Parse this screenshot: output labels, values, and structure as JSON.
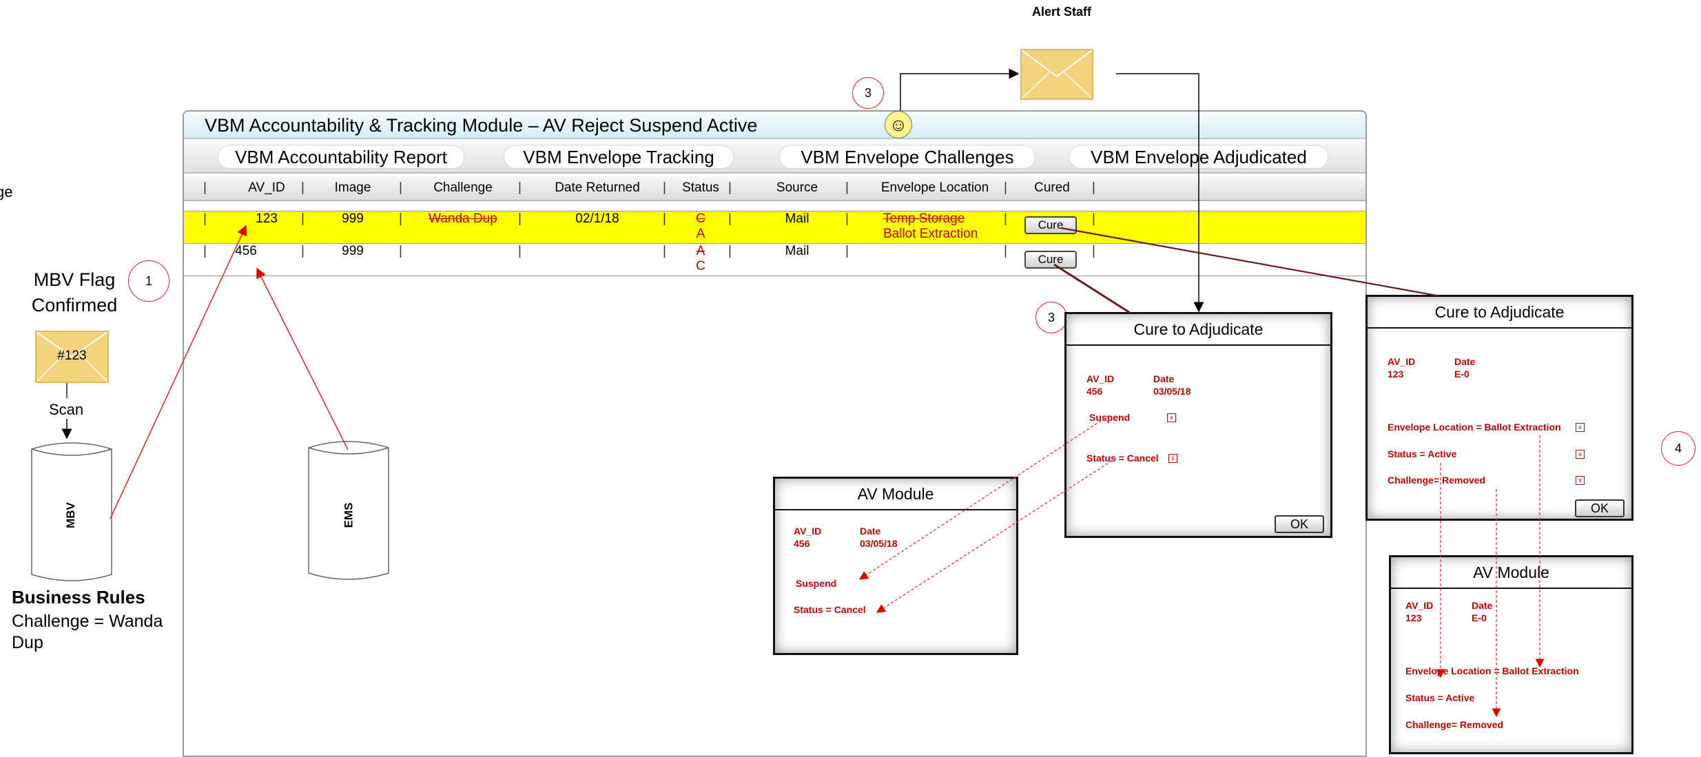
{
  "alert_staff": "Alert Staff",
  "module": {
    "title": "VBM Accountability & Tracking Module – AV Reject Suspend Active",
    "tabs": [
      "VBM Accountability Report",
      "VBM Envelope Tracking",
      "VBM Envelope Challenges",
      "VBM Envelope Adjudicated"
    ],
    "columns": [
      "AV_ID",
      "Image",
      "Challenge",
      "Date Returned",
      "Status",
      "Source",
      "Envelope Location",
      "Cured"
    ],
    "rows": [
      {
        "av_id": "123",
        "image": "999",
        "challenge": "Wanda Dup",
        "date_returned": "02/1/18",
        "status_old": "C",
        "status_new": "A",
        "source": "Mail",
        "location_old": "Temp Storage",
        "location_new": "Ballot Extraction",
        "cure": "Cure"
      },
      {
        "av_id": "456",
        "image": "999",
        "challenge": "",
        "date_returned": "",
        "status_old": "A",
        "status_new": "C",
        "source": "Mail",
        "location_old": "",
        "location_new": "",
        "cure": "Cure"
      }
    ]
  },
  "left": {
    "partial_label": "ge",
    "flag_label_1": "MBV Flag",
    "flag_label_2": "Confirmed",
    "step1": "1",
    "envelope_label": "#123",
    "scan": "Scan",
    "mbv": "MBV",
    "ems": "EMS",
    "rules_title": "Business Rules",
    "rules_text_1": "Challenge = Wanda",
    "rules_text_2": "Dup"
  },
  "steps": {
    "s3a": "3",
    "s3b": "3",
    "s4": "4"
  },
  "cure_dialog_456": {
    "title": "Cure to Adjudicate",
    "av_id_label": "AV_ID",
    "av_id": "456",
    "date_label": "Date",
    "date": "03/05/18",
    "suspend": "Suspend",
    "status": "Status = Cancel",
    "ok": "OK"
  },
  "av_module_456": {
    "title": "AV Module",
    "av_id_label": "AV_ID",
    "av_id": "456",
    "date_label": "Date",
    "date": "03/05/18",
    "suspend": "Suspend",
    "status": "Status = Cancel"
  },
  "cure_dialog_123": {
    "title": "Cure to Adjudicate",
    "av_id_label": "AV_ID",
    "av_id": "123",
    "date_label": "Date",
    "date": "E-0",
    "location": "Envelope Location =  Ballot Extraction",
    "status": "Status = Active",
    "challenge": "Challenge= Removed",
    "ok": "OK"
  },
  "av_module_123": {
    "title": "AV Module",
    "av_id_label": "AV_ID",
    "av_id": "123",
    "date_label": "Date",
    "date": "E-0",
    "location": "Envelope Location =  Ballot Extraction",
    "status": "Status = Active",
    "challenge": "Challenge= Removed"
  },
  "colors": {
    "highlight": "#ffff00",
    "annotation": "#c00000",
    "envelope": "#f3d27d"
  }
}
